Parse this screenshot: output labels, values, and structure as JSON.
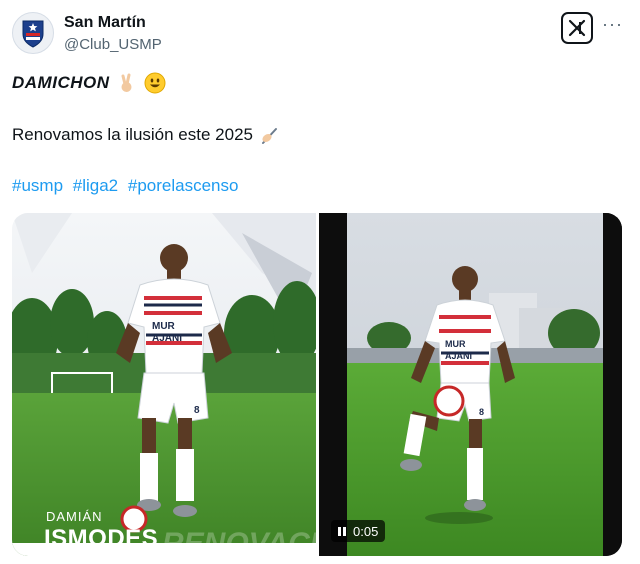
{
  "account": {
    "name": "San Martín",
    "handle": "@Club_USMP",
    "avatar_icon": "club-crest-icon"
  },
  "header_icons": {
    "logo": "x-grok-icon",
    "more": "···"
  },
  "tweet": {
    "line1_text": "DAMICHON",
    "line1_emojis": [
      "victory-hand-emoji",
      "grinning-face-emoji"
    ],
    "line2_text": "Renovamos la ilusión este 2025",
    "line2_emoji": "writing-hand-emoji",
    "hashtags": [
      "#usmp",
      "#liga2",
      "#porelascenso"
    ]
  },
  "media": {
    "photo": {
      "caption_first": "DAMIÁN",
      "caption_last": "ISMODES",
      "jersey_text_1": "MUR",
      "jersey_text_2": "AJANI",
      "jersey_number": "8"
    },
    "video": {
      "time": "0:05",
      "jersey_text_1": "MUR",
      "jersey_text_2": "AJANI",
      "jersey_number": "8"
    }
  },
  "colors": {
    "link": "#1d9bf0",
    "secondary_text": "#536471",
    "grass": "#4f9a32",
    "sky": "#d7dde3"
  }
}
